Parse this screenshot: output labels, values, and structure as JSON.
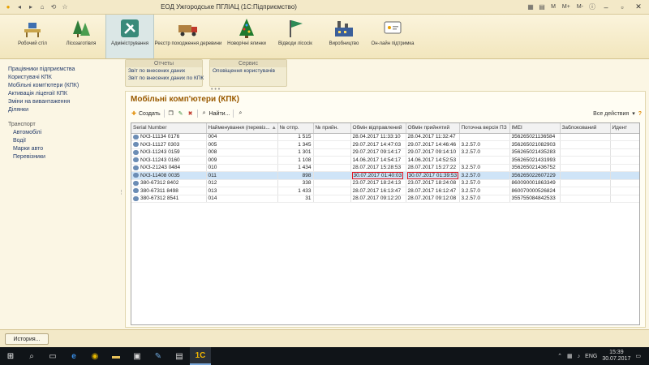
{
  "window": {
    "title": "ЕОД Ужгородське ПГЛІАЦ (1С:Підприємство)",
    "right_buttons": [
      "M",
      "M+",
      "M-"
    ]
  },
  "sections": [
    {
      "label": "Робочий стіл",
      "icon": "desk-icon",
      "active": false
    },
    {
      "label": "Лісозаготівля",
      "icon": "forest-icon",
      "active": false
    },
    {
      "label": "Адміністрування",
      "icon": "admin-tools-icon",
      "active": true
    },
    {
      "label": "Реєстр походження деревини",
      "icon": "truck-icon",
      "active": false,
      "wide": true
    },
    {
      "label": "Новорічні ялинки",
      "icon": "christmas-tree-icon",
      "active": false
    },
    {
      "label": "Відводи лісосік",
      "icon": "flag-icon",
      "active": false
    },
    {
      "label": "Виробництво",
      "icon": "factory-icon",
      "active": false
    },
    {
      "label": "Он-лайн підтримка",
      "icon": "online-support-icon",
      "active": false
    }
  ],
  "leftnav": {
    "items": [
      "Працівники підприємства",
      "Користувачі КПК",
      "Мобільні комп'ютери (КПК)",
      "Активація ліцензії КПК",
      "Зміни на вивантаження",
      "Ділянки"
    ],
    "group_title": "Транспорт",
    "group_items": [
      "Автомобілі",
      "Водії",
      "Марки авто",
      "Перевізники"
    ]
  },
  "actions": {
    "reports_title": "Отчеты",
    "reports": [
      "Звіт по внесених даних",
      "Звіт по внесених даних по КПК"
    ],
    "service_title": "Сервис",
    "service": [
      "Оповіщення користувачів"
    ]
  },
  "form": {
    "title": "Мобільні комп'ютери (КПК)",
    "create_label": "Создать",
    "find_label": "Найти...",
    "all_actions_label": "Все действия",
    "help_label": "?"
  },
  "table": {
    "columns": [
      "Serial Number",
      "Найменування (перевіз...",
      "№ отпр.",
      "№ прийн.",
      "Обмін відправлений",
      "Обмін прийнятий",
      "Поточна версія ПЗ",
      "IMEI",
      "Заблокований",
      "Идент"
    ],
    "rows": [
      {
        "serial": "NX3-11134 0176",
        "name": "004",
        "sent": "1 515",
        "recv": "",
        "exch_sent": "28.04.2017 11:33:10",
        "exch_recv": "28.04.2017 11:32:47",
        "version": "",
        "imei": "356265021136584",
        "blocked": "",
        "ident": ""
      },
      {
        "serial": "NX3-11127 0303",
        "name": "005",
        "sent": "1 345",
        "recv": "",
        "exch_sent": "29.07.2017 14:47:03",
        "exch_recv": "29.07.2017 14:46:46",
        "version": "3.2.57.0",
        "imei": "356265021082903",
        "blocked": "",
        "ident": ""
      },
      {
        "serial": "NX3-11243 0159",
        "name": "008",
        "sent": "1 301",
        "recv": "",
        "exch_sent": "29.07.2017 09:14:17",
        "exch_recv": "29.07.2017 09:14:10",
        "version": "3.2.57.0",
        "imei": "356265021435283",
        "blocked": "",
        "ident": ""
      },
      {
        "serial": "NX3-11243 0160",
        "name": "009",
        "sent": "1 108",
        "recv": "",
        "exch_sent": "14.06.2017 14:54:17",
        "exch_recv": "14.06.2017 14:52:53",
        "version": "",
        "imei": "356265021431993",
        "blocked": "",
        "ident": ""
      },
      {
        "serial": "NX3-21243 0484",
        "name": "010",
        "sent": "1 434",
        "recv": "",
        "exch_sent": "28.07.2017 15:28:53",
        "exch_recv": "28.07.2017 15:27:22",
        "version": "3.2.57.0",
        "imei": "356265021436752",
        "blocked": "",
        "ident": ""
      },
      {
        "serial": "NX3-11408 0035",
        "name": "011",
        "sent": "898",
        "recv": "",
        "exch_sent": "30.07.2017 01:40:03",
        "exch_recv": "30.07.2017 01:39:53",
        "version": "3.2.57.0",
        "imei": "356265022607229",
        "blocked": "",
        "ident": "",
        "selected": true
      },
      {
        "serial": "380-67312 8402",
        "name": "012",
        "sent": "338",
        "recv": "",
        "exch_sent": "23.07.2017 18:24:13",
        "exch_recv": "23.07.2017 18:24:08",
        "version": "3.2.57.0",
        "imei": "860090001863349",
        "blocked": "",
        "ident": ""
      },
      {
        "serial": "380-67311 8498",
        "name": "013",
        "sent": "1 433",
        "recv": "",
        "exch_sent": "28.07.2017 16:13:47",
        "exch_recv": "28.07.2017 16:12:47",
        "version": "3.2.57.0",
        "imei": "860070000526824",
        "blocked": "",
        "ident": ""
      },
      {
        "serial": "380-67312 8541",
        "name": "014",
        "sent": "31",
        "recv": "",
        "exch_sent": "28.07.2017 09:12:20",
        "exch_recv": "28.07.2017 09:12:08",
        "version": "3.2.57.0",
        "imei": "355755084842533",
        "blocked": "",
        "ident": ""
      }
    ]
  },
  "history_button": "История...",
  "taskbar": {
    "lang": "ENG",
    "time": "15:39",
    "date": "30.07.2017"
  },
  "colors": {
    "accent_title": "#9a5a00",
    "selection": "#cfe4f7",
    "highlight": "#e01b24"
  }
}
